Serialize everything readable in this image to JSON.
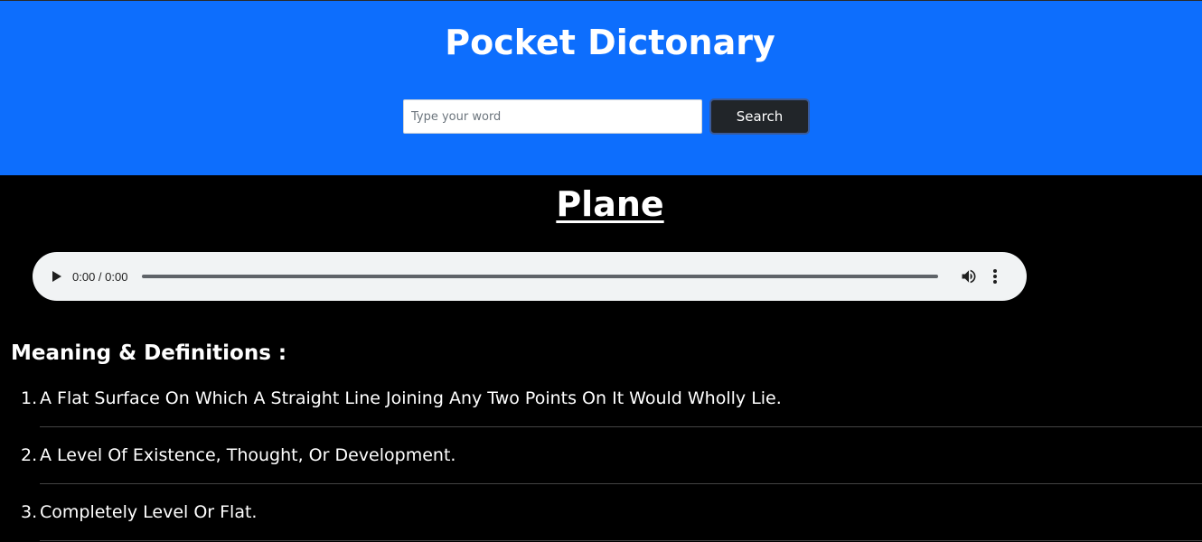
{
  "header": {
    "app_title": "Pocket Dictonary",
    "search_placeholder": "Type your word",
    "search_value": "",
    "search_button_label": "Search",
    "background_color": "#0d6efd"
  },
  "word": {
    "title": "Plane"
  },
  "audio": {
    "time_display": "0:00 / 0:00",
    "icons": [
      "play-icon",
      "volume-icon",
      "more-options-icon"
    ]
  },
  "meanings": {
    "heading": "Meaning & Definitions :",
    "definitions": [
      {
        "number": "1.",
        "text": "A Flat Surface On Which A Straight Line Joining Any Two Points On It Would Wholly Lie."
      },
      {
        "number": "2.",
        "text": "A Level Of Existence, Thought, Or Development."
      },
      {
        "number": "3.",
        "text": "Completely Level Or Flat."
      }
    ]
  }
}
